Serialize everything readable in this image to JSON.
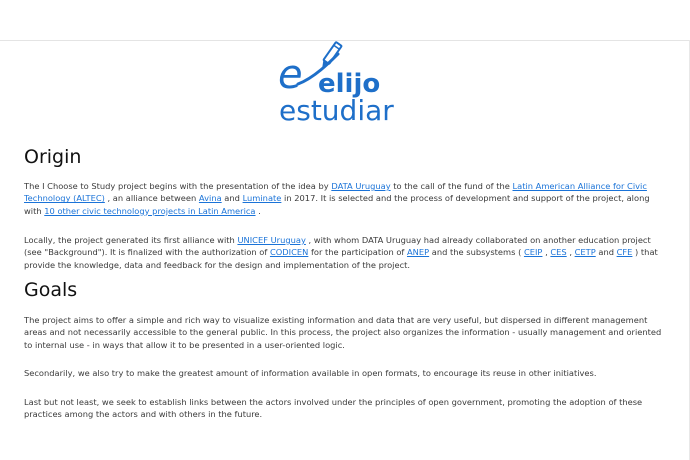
{
  "logo": {
    "brand_e": "e",
    "brand_line1": "elijo",
    "brand_line2": "estudiar",
    "pencil_icon": "pencil-icon",
    "color": "#1e6fc9"
  },
  "origin": {
    "heading": "Origin",
    "p1": {
      "t1": "The I Choose to Study project begins with the presentation of the idea by ",
      "l1": "DATA Uruguay",
      "t2": " to the call of the fund of the ",
      "l2": "Latin American Alliance for Civic Technology (ALTEC)",
      "t3": " , an alliance between ",
      "l3": "Avina",
      "t4": " and ",
      "l4": "Luminate",
      "t5": " in 2017. It is selected and the process of development and support of the project, along with ",
      "l5": "10 other civic technology projects in Latin America",
      "t6": " ."
    },
    "p2": {
      "t1": "Locally, the project generated its first alliance with ",
      "l1": "UNICEF Uruguay",
      "t2": " , with whom DATA Uruguay had already collaborated on another education project (see \"Background\"). It is finalized with the authorization of ",
      "l2": "CODICEN",
      "t3": " for the participation of ",
      "l3": "ANEP",
      "t4": " and the subsystems ( ",
      "l4": "CEIP",
      "t5": " , ",
      "l5": "CES",
      "t6": " , ",
      "l6": "CETP",
      "t7": " and ",
      "l7": "CFE",
      "t8": " ) that provide the knowledge, data and feedback for the design and implementation of the project."
    }
  },
  "goals": {
    "heading": "Goals",
    "p3": "The project aims to offer a simple and rich way to visualize existing information and data that are very useful, but dispersed in different management areas and not necessarily accessible to the general public. In this process, the project also organizes the information - usually management and oriented to internal use - in ways that allow it to be presented in a user-oriented logic.",
    "p4": "Secondarily, we also try to make the greatest amount of information available in open formats, to encourage its reuse in other initiatives.",
    "p5": "Last but not least, we seek to establish links between the actors involved under the principles of open government, promoting the adoption of these practices among the actors and with others in the future."
  },
  "colors": {
    "link": "#1a73d8",
    "text": "#3a3a3a",
    "heading": "#111111"
  }
}
